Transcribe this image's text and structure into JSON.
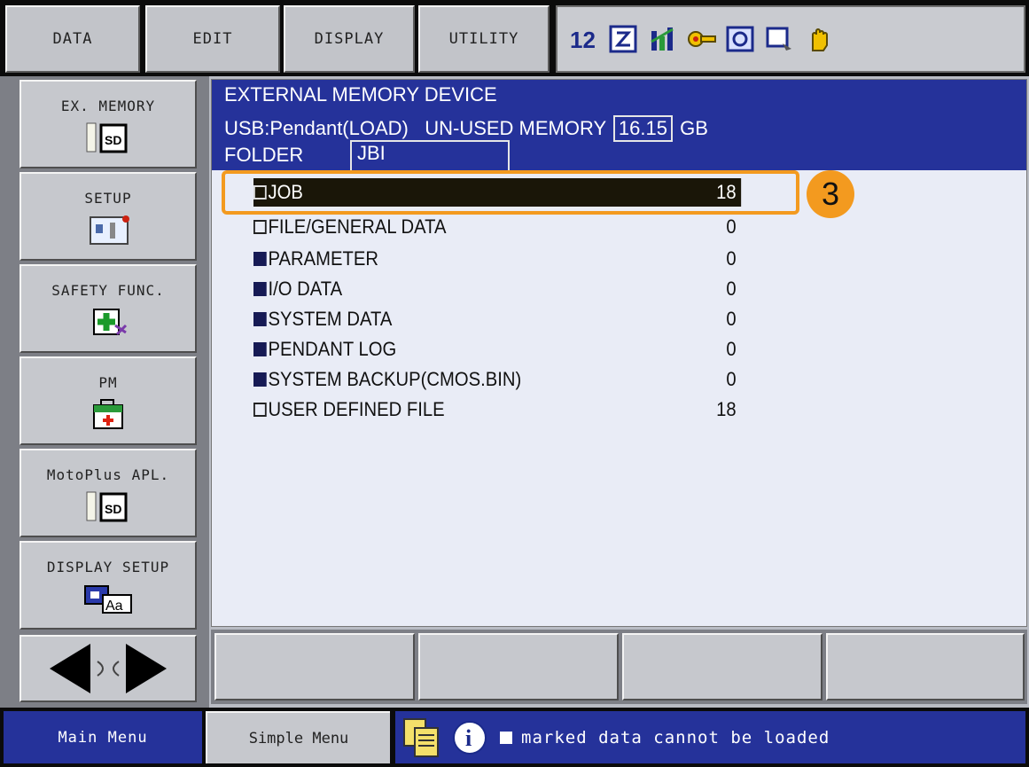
{
  "top_menu": {
    "data": "DATA",
    "edit": "EDIT",
    "display": "DISPLAY",
    "utility": "UTILITY"
  },
  "status_icons": [
    "numbers-icon",
    "edit-mode-icon",
    "chart-icon",
    "key-icon",
    "camera-icon",
    "screen-icon",
    "hand-icon"
  ],
  "side_menu": {
    "ex_memory": "EX. MEMORY",
    "setup": "SETUP",
    "safety_func": "SAFETY FUNC.",
    "pm": "PM",
    "motoplus_apl": "MotoPlus APL.",
    "display_setup": "DISPLAY SETUP",
    "sd_text": "SD",
    "aa_text": "Aa"
  },
  "header": {
    "title": "EXTERNAL MEMORY DEVICE",
    "device": "USB:Pendant(LOAD)",
    "unused_label": "UN-USED MEMORY",
    "unused_value": "16.15",
    "unused_unit": "GB",
    "folder_label": "FOLDER",
    "folder_value": "JBI"
  },
  "rows": [
    {
      "label": "JOB",
      "count": "18"
    },
    {
      "label": "FILE/GENERAL DATA",
      "count": "0"
    },
    {
      "label": "PARAMETER",
      "count": "0"
    },
    {
      "label": "I/O DATA",
      "count": "0"
    },
    {
      "label": "SYSTEM DATA",
      "count": "0"
    },
    {
      "label": "PENDANT LOG",
      "count": "0"
    },
    {
      "label": "SYSTEM BACKUP(CMOS.BIN)",
      "count": "0"
    },
    {
      "label": "USER DEFINED FILE",
      "count": "18"
    }
  ],
  "annotation": {
    "step": "3"
  },
  "bottom": {
    "main_menu": "Main Menu",
    "simple_menu": "Simple Menu",
    "message": "marked data cannot be loaded"
  },
  "colors": {
    "header_bg": "#25329a",
    "highlight": "#f39a1f",
    "selected_row": "#1a1608",
    "content_bg": "#e9ecf6"
  }
}
